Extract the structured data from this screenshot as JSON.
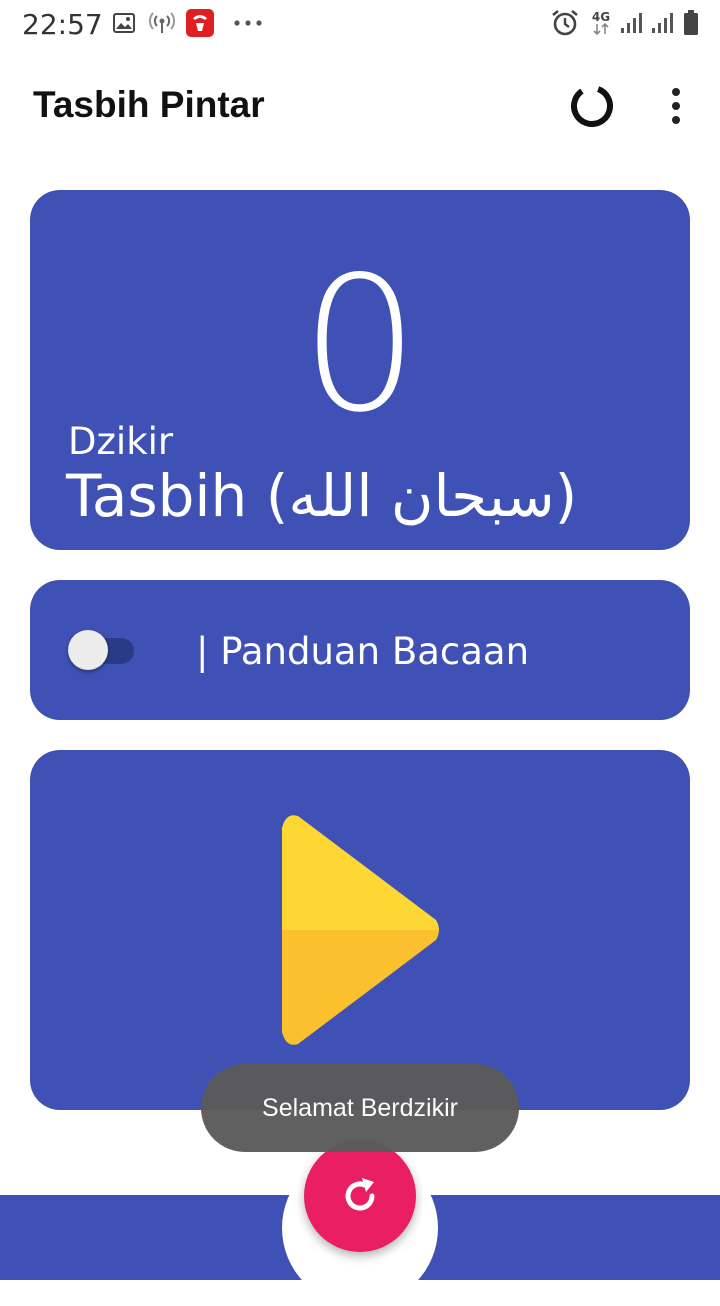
{
  "status_bar": {
    "time": "22:57",
    "network": "4G",
    "icons": [
      "image-icon",
      "hotspot-icon",
      "telkomsel-icon",
      "more-notifications-icon",
      "alarm-icon",
      "network-4g-icon",
      "signal-icon",
      "signal-icon",
      "battery-icon"
    ]
  },
  "app_bar": {
    "title": "Tasbih Pintar",
    "icons": [
      "progress-ring-icon",
      "more-vert-icon"
    ]
  },
  "counter": {
    "value": "0",
    "label": "Dzikir",
    "dzikir_name": "Tasbih (سبحان الله)"
  },
  "guide": {
    "toggle_on": false,
    "label": "| Panduan Bacaan"
  },
  "player": {
    "icon": "play-icon",
    "colors": {
      "top": "#fdd835",
      "bottom": "#fbc02d"
    }
  },
  "toast": {
    "message": "Selamat Berdzikir"
  },
  "fab": {
    "icon": "refresh-icon",
    "color": "#e91e63"
  },
  "theme": {
    "primary": "#3f51b5",
    "accent": "#e91e63"
  }
}
